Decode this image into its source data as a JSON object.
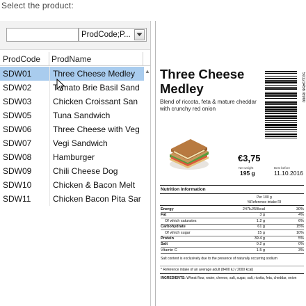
{
  "prompt": "Select the product:",
  "filter": {
    "input_value": "",
    "select_value": "ProdCode;P..."
  },
  "table": {
    "headers": {
      "code": "ProdCode",
      "name": "ProdName"
    },
    "rows": [
      {
        "code": "SDW01",
        "name": "Three Cheese Medley"
      },
      {
        "code": "SDW02",
        "name": "Tomato Brie Basil Sand"
      },
      {
        "code": "SDW03",
        "name": "Chicken Croissant San"
      },
      {
        "code": "SDW05",
        "name": "Tuna Sandwich"
      },
      {
        "code": "SDW06",
        "name": "Three Cheese with Veg"
      },
      {
        "code": "SDW07",
        "name": "Vegi Sandwich"
      },
      {
        "code": "SDW08",
        "name": "Hamburger"
      },
      {
        "code": "SDW09",
        "name": "Chili Cheese Dog"
      },
      {
        "code": "SDW10",
        "name": "Chicken & Bacon Melt"
      },
      {
        "code": "SDW11",
        "name": "Chicken Bacon Pita Sar"
      }
    ],
    "selected_index": 0
  },
  "label": {
    "title": "Three Cheese Medley",
    "description": "Blend of riccota, feta & mature cheddar with crunchy red onion",
    "barcode_digits": "5012345678900",
    "price": "€3,75",
    "net_weight_label": "Net weight",
    "net_weight": "195 g",
    "best_before_label": "Best before",
    "best_before": "11.10.2016",
    "nutrition_title": "Nutrition Information",
    "nutrition_header_per": "Per 100 g",
    "nutrition_header_ri": "%Reference intake RI",
    "nutrition": [
      {
        "name": "Energy",
        "v1": "247kJ/59kcal",
        "v2": "30%",
        "style": "bold"
      },
      {
        "name": "Fat",
        "v1": "3 g",
        "v2": "4%",
        "style": "bold"
      },
      {
        "name": "Of which saturates",
        "v1": "1.2 g",
        "v2": "6%",
        "style": "sub"
      },
      {
        "name": "Carbohydrate",
        "v1": "61 g",
        "v2": "15%",
        "style": "bold"
      },
      {
        "name": "Of which sugar",
        "v1": "15 g",
        "v2": "10%",
        "style": "sub"
      },
      {
        "name": "Protein",
        "v1": "39.4 g",
        "v2": "5%",
        "style": "bold"
      },
      {
        "name": "Salt",
        "v1": "0.2 g",
        "v2": "0%",
        "style": "bold"
      },
      {
        "name": "Vitamin C",
        "v1": "1.5 g",
        "v2": "3%",
        "style": "normal"
      }
    ],
    "salt_note": "Salt content is exclusively due to the presence of naturally occurring sodium",
    "ri_note": "* Reference intake of an average adult (8400 kJ / 2000 kcal)",
    "ingredients_label": "INGREDIENTS:",
    "ingredients": "Wheat flour, water, cheese, salt, sugar, salt, ricotta, feta, cheddar, onion"
  }
}
